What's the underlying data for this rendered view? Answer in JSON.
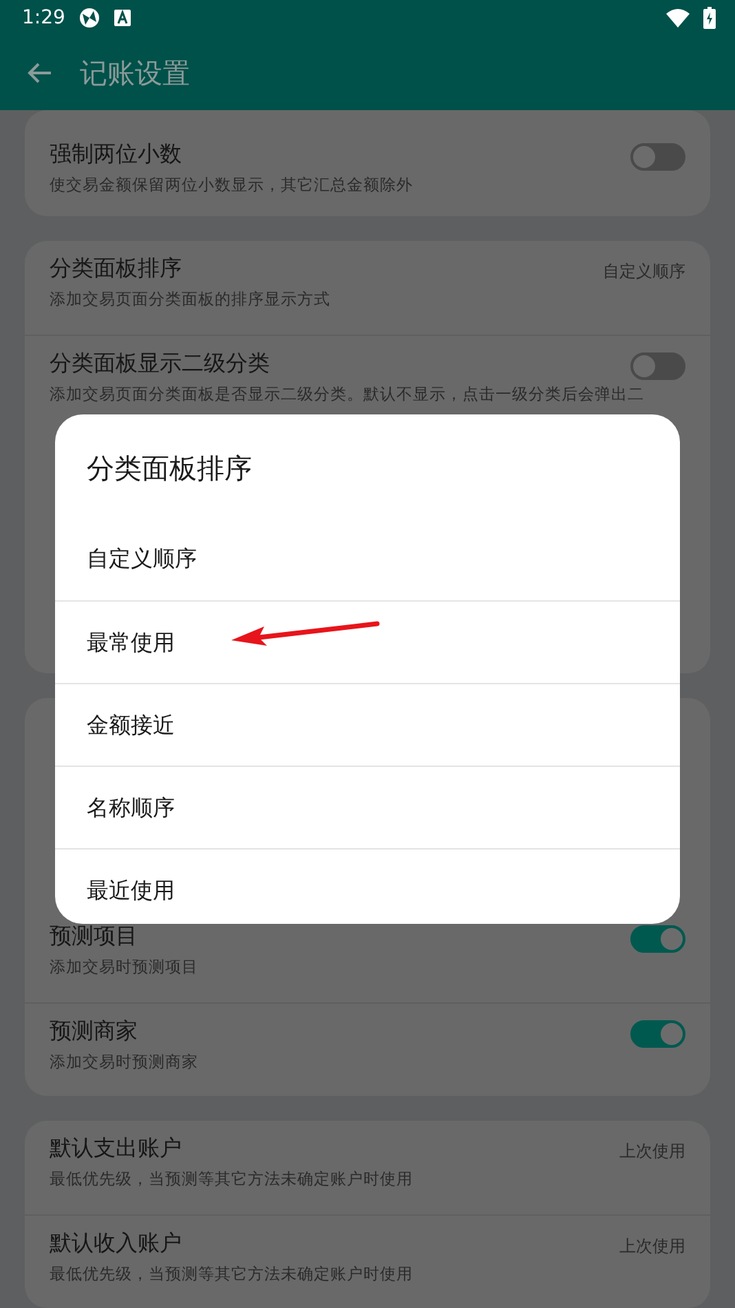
{
  "status_bar": {
    "time": "1:29"
  },
  "app_bar": {
    "title": "记账设置"
  },
  "cards": [
    {
      "rows": [
        {
          "kind": "toggle",
          "title": "强制两位小数",
          "description": "使交易金额保留两位小数显示，其它汇总金额除外",
          "on": false
        }
      ]
    },
    {
      "rows": [
        {
          "kind": "value",
          "title": "分类面板排序",
          "description": "添加交易页面分类面板的排序显示方式",
          "value": "自定义顺序"
        },
        {
          "kind": "toggle",
          "title": "分类面板显示二级分类",
          "description": "添加交易页面分类面板是否显示二级分类。默认不显示，点击一级分类后会弹出二",
          "on": false
        }
      ]
    },
    {
      "rows": [
        {
          "kind": "toggle",
          "title": "预测项目",
          "description": "添加交易时预测项目",
          "on": true
        },
        {
          "kind": "toggle",
          "title": "预测商家",
          "description": "添加交易时预测商家",
          "on": true
        }
      ]
    },
    {
      "rows": [
        {
          "kind": "value",
          "title": "默认支出账户",
          "description": "最低优先级，当预测等其它方法未确定账户时使用",
          "value": "上次使用"
        },
        {
          "kind": "value",
          "title": "默认收入账户",
          "description": "最低优先级，当预测等其它方法未确定账户时使用",
          "value": "上次使用"
        }
      ]
    }
  ],
  "dialog": {
    "title": "分类面板排序",
    "options": [
      "自定义顺序",
      "最常使用",
      "金额接近",
      "名称顺序",
      "最近使用"
    ]
  }
}
